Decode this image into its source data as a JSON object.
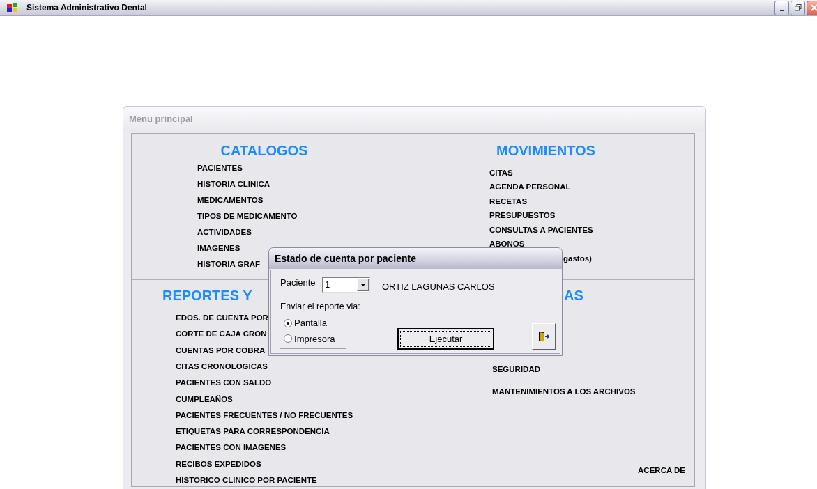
{
  "window": {
    "title": "Sistema Administrativo Dental"
  },
  "menu_window": {
    "title": "Menu principal",
    "sections": [
      {
        "title": "CATALOGOS",
        "items": [
          "PACIENTES",
          "HISTORIA CLINICA",
          "MEDICAMENTOS",
          "TIPOS DE MEDICAMENTO",
          "ACTIVIDADES",
          "IMAGENES",
          "HISTORIA GRAF"
        ]
      },
      {
        "title": "MOVIMIENTOS",
        "items": [
          "CITAS",
          "AGENDA PERSONAL",
          "RECETAS",
          "PRESUPUESTOS",
          "CONSULTAS A PACIENTES",
          "ABONOS",
          "gastos)"
        ]
      },
      {
        "title": "REPORTES Y",
        "items": [
          "EDOS. DE CUENTA POR",
          "CORTE DE CAJA CRON",
          "CUENTAS POR COBRA",
          "CITAS CRONOLOGICAS",
          "PACIENTES CON SALDO",
          "CUMPLEAÑOS",
          "PACIENTES FRECUENTES /  NO FRECUENTES",
          "ETIQUETAS PARA CORRESPONDENCIA",
          "PACIENTES CON IMAGENES",
          "RECIBOS EXPEDIDOS",
          "HISTORICO CLINICO POR PACIENTE"
        ]
      },
      {
        "title": "AS",
        "items": [
          "SEGURIDAD",
          "MANTENIMIENTOS A LOS ARCHIVOS"
        ],
        "footer_item": "ACERCA DE"
      }
    ]
  },
  "dialog": {
    "title": "Estado de cuenta por paciente",
    "patient_label": "Paciente",
    "patient_value": "1",
    "patient_name": "ORTIZ LAGUNAS CARLOS",
    "send_label": "Enviar el reporte via:",
    "options": [
      {
        "label": "Pantalla",
        "selected": true
      },
      {
        "label": "Impresora",
        "selected": false
      }
    ],
    "execute_button": "Ejecutar"
  }
}
